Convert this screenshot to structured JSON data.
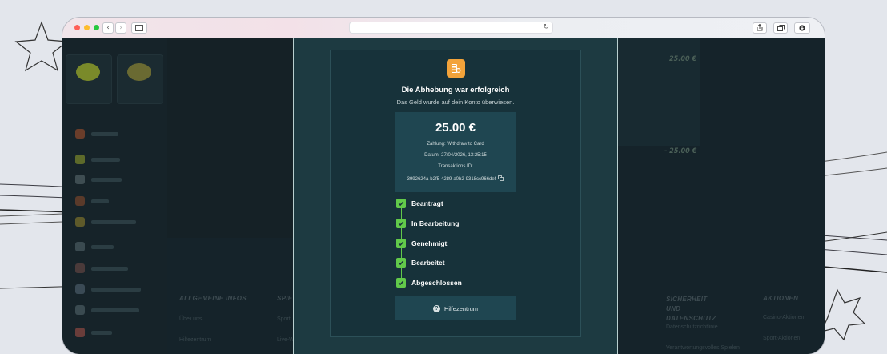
{
  "browser": {
    "traffic_lights": [
      "#ff5f57",
      "#febc2e",
      "#28c840"
    ],
    "back_icon": "chevron-left-icon",
    "forward_icon": "chevron-right-icon",
    "sidebar_icon": "sidebar-icon",
    "reload_icon": "reload-icon",
    "share_icon": "share-icon",
    "tabs_icon": "tabs-icon",
    "download_icon": "download-icon"
  },
  "modal": {
    "icon": "coins-icon",
    "title": "Die Abhebung war erfolgreich",
    "subtitle": "Das Geld wurde auf dein Konto überwiesen.",
    "amount": "25.00 €",
    "payment": "Zahlung: Withdraw to Card",
    "date": "Datum: 27/04/2026, 13:25:15",
    "transaction_label": "Transaktions ID:",
    "transaction_id": "3992624a-b2f5-4289-a0b2-9318cc966def",
    "steps": [
      {
        "label": "Beantragt"
      },
      {
        "label": "In Bearbeitung"
      },
      {
        "label": "Genehmigt"
      },
      {
        "label": "Bearbeitet"
      },
      {
        "label": "Abgeschlossen"
      }
    ],
    "help_label": "Hilfezentrum"
  },
  "background": {
    "right_amount_1": "25.00 €",
    "right_amount_2": "- 25.00 €",
    "footer_col1_title": "ALLGEMEINE INFOS",
    "footer_col1_links": [
      "Über uns",
      "Hilfezentrum"
    ],
    "footer_col2_title": "SPIE",
    "footer_col2_links": [
      "Sport",
      "Live-W"
    ],
    "footer_col3_title": "SICHERHEIT UND DATENSCHUTZ",
    "footer_col3_links": [
      "Datenschutzrichtlinie",
      "Verantwortungsvolles Spielen"
    ],
    "footer_col4_title": "AKTIONEN",
    "footer_col4_links": [
      "Casino-Aktionen",
      "Sport-Aktionen"
    ]
  },
  "colors": {
    "accent_orange": "#f3a33a",
    "success_green": "#62c94a",
    "modal_bg": "#17323a",
    "card_bg": "#1f4651"
  }
}
